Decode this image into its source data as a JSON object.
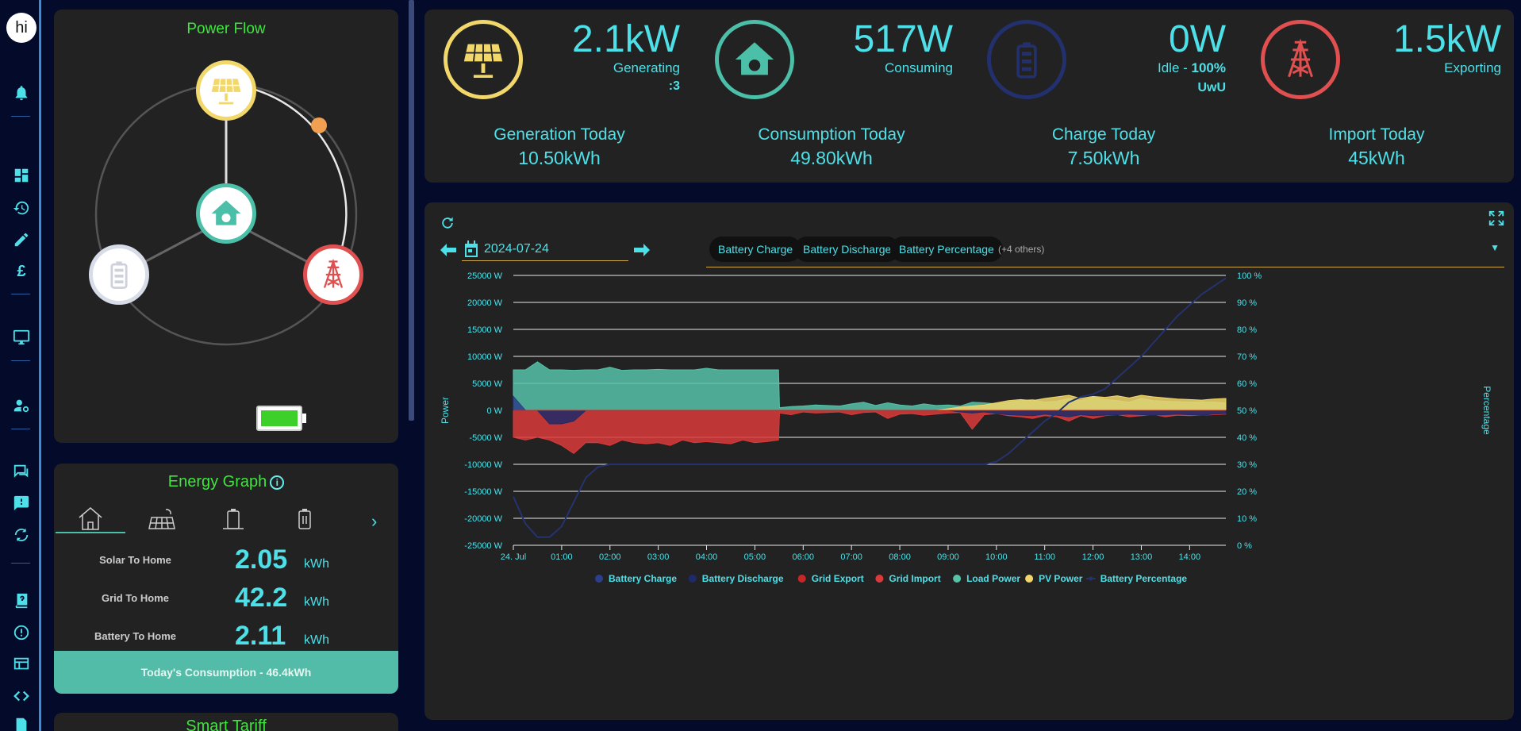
{
  "sidebar": {
    "avatar_text": "hi",
    "icons": [
      "bell-icon",
      "dashboard-icon",
      "history-icon",
      "edit-icon",
      "pound-icon",
      "monitor-icon",
      "user-settings-icon",
      "chat-icon",
      "feedback-icon",
      "sync-icon",
      "help-book-icon",
      "alert-icon",
      "table-edit-icon",
      "code-icon",
      "export-icon"
    ]
  },
  "power_flow": {
    "title": "Power Flow",
    "nodes": [
      "solar-panel-icon",
      "home-icon",
      "battery-icon",
      "grid-tower-icon"
    ],
    "colors": {
      "solar": "#f2d86a",
      "home": "#4bbfa8",
      "battery": "#d8dce8",
      "grid": "#e05050",
      "dot": "#f0a050"
    }
  },
  "energy_graph": {
    "title": "Energy Graph",
    "info_icon": "i",
    "tabs": [
      "home-icon",
      "solar-panels-icon",
      "battery-charge-icon",
      "battery-icon"
    ],
    "next_icon": "›",
    "rows": [
      {
        "label": "Solar To Home",
        "value": "2.05",
        "unit": "kWh"
      },
      {
        "label": "Grid To Home",
        "value": "42.2",
        "unit": "kWh"
      },
      {
        "label": "Battery To Home",
        "value": "2.11",
        "unit": "kWh"
      }
    ],
    "total": "Today's Consumption - 46.4kWh"
  },
  "smart_tariff": {
    "title": "Smart Tariff"
  },
  "stats": {
    "items": [
      {
        "value": "2.1kW",
        "label": "Generating",
        "sub": ":3",
        "icon": "solar-panel-icon",
        "color": "#f2d86a"
      },
      {
        "value": "517W",
        "label": "Consuming",
        "sub": "",
        "icon": "home-icon",
        "color": "#4bbfa8"
      },
      {
        "value": "0W",
        "label_prefix": "Idle - ",
        "label_bold": "100%",
        "sub": "UwU",
        "icon": "battery-icon",
        "color": "#22306e"
      },
      {
        "value": "1.5kW",
        "label": "Exporting",
        "sub": "",
        "icon": "grid-tower-icon",
        "color": "#e05050"
      }
    ],
    "today": [
      {
        "label": "Generation Today",
        "value": "10.50kWh"
      },
      {
        "label": "Consumption Today",
        "value": "49.80kWh"
      },
      {
        "label": "Charge Today",
        "value": "7.50kWh"
      },
      {
        "label": "Import Today",
        "value": "45kWh"
      }
    ]
  },
  "chart_controls": {
    "date": "2024-07-24",
    "chips": [
      "Battery Charge",
      "Battery Discharge",
      "Battery Percentage"
    ],
    "more": "(+4 others)",
    "dropdown": "▼"
  },
  "chart_data": {
    "type": "area",
    "ylabel_left": "Power",
    "ylabel_right": "Percentage",
    "ylim": [
      -25000,
      25000
    ],
    "y2lim": [
      0,
      100
    ],
    "yticks": [
      "25000 W",
      "20000 W",
      "15000 W",
      "10000 W",
      "5000 W",
      "0 W",
      "-5000 W",
      "-10000 W",
      "-15000 W",
      "-20000 W",
      "-25000 W"
    ],
    "y2ticks": [
      "100 %",
      "90 %",
      "80 %",
      "70 %",
      "60 %",
      "50 %",
      "40 %",
      "30 %",
      "20 %",
      "10 %",
      "0 %"
    ],
    "xticks": [
      "24. Jul",
      "01:00",
      "02:00",
      "03:00",
      "04:00",
      "05:00",
      "06:00",
      "07:00",
      "08:00",
      "09:00",
      "10:00",
      "11:00",
      "12:00",
      "13:00",
      "14:00"
    ],
    "xlim": [
      0,
      14.75
    ],
    "x": [
      0,
      0.25,
      0.5,
      0.75,
      1,
      1.25,
      1.5,
      1.75,
      2,
      2.25,
      2.5,
      2.75,
      3,
      3.25,
      3.5,
      3.75,
      4,
      4.25,
      4.5,
      4.75,
      5,
      5.25,
      5.49,
      5.51,
      5.75,
      6,
      6.25,
      6.5,
      6.75,
      7,
      7.25,
      7.5,
      7.75,
      8,
      8.25,
      8.5,
      8.75,
      9,
      9.25,
      9.5,
      9.75,
      10,
      10.25,
      10.5,
      10.75,
      11,
      11.25,
      11.5,
      11.75,
      12,
      12.25,
      12.5,
      12.75,
      13,
      13.25,
      13.5,
      13.75,
      14,
      14.25,
      14.5,
      14.75
    ],
    "series": [
      {
        "name": "Battery Charge",
        "color": "#2c3f8c",
        "values": [
          2600,
          0,
          0,
          0,
          0,
          0,
          0,
          0,
          0,
          0,
          0,
          0,
          0,
          0,
          0,
          0,
          0,
          0,
          0,
          0,
          0,
          0,
          0,
          0,
          0,
          0,
          0,
          0,
          0,
          0,
          0,
          0,
          0,
          0,
          0,
          0,
          0,
          0,
          0,
          0,
          0,
          0,
          0,
          0,
          0,
          0,
          0,
          0,
          0,
          0,
          0,
          0,
          0,
          0,
          0,
          0,
          0,
          0,
          0,
          0,
          0
        ]
      },
      {
        "name": "Battery Discharge",
        "color": "#1f2a6a",
        "values": [
          0,
          0,
          0,
          -2500,
          -2500,
          -2000,
          0,
          0,
          0,
          0,
          0,
          0,
          0,
          0,
          0,
          0,
          0,
          0,
          0,
          0,
          0,
          0,
          0,
          0,
          0,
          0,
          0,
          0,
          0,
          0,
          0,
          0,
          0,
          0,
          0,
          0,
          0,
          0,
          -300,
          -500,
          -300,
          -600,
          -800,
          -900,
          -1000,
          -700,
          -900,
          -1200,
          -800,
          -1000,
          -900,
          -800,
          -700,
          -800,
          -900,
          -800,
          -700,
          -800,
          -900,
          -700,
          -600
        ]
      },
      {
        "name": "Grid Export",
        "color": "#c62828",
        "values": [
          0,
          0,
          0,
          0,
          0,
          0,
          0,
          0,
          0,
          0,
          0,
          0,
          0,
          0,
          0,
          0,
          0,
          0,
          0,
          0,
          0,
          0,
          0,
          0,
          0,
          0,
          0,
          0,
          0,
          0,
          0,
          0,
          0,
          0,
          0,
          0,
          0,
          0,
          0,
          0,
          0,
          0,
          0,
          0,
          0,
          0,
          0,
          0,
          0,
          0,
          0,
          0,
          0,
          0,
          0,
          0,
          0,
          0,
          0,
          0,
          0
        ]
      },
      {
        "name": "Grid Import",
        "color": "#d93a3a",
        "values": [
          -5000,
          -5500,
          -5000,
          -5500,
          -6500,
          -8000,
          -6000,
          -6000,
          -6500,
          -5500,
          -6000,
          -6200,
          -6000,
          -6500,
          -5500,
          -6000,
          -5800,
          -6000,
          -6200,
          -5500,
          -6000,
          -5800,
          -5500,
          -500,
          -800,
          -300,
          -500,
          -400,
          -300,
          -800,
          -400,
          -300,
          -1500,
          -700,
          -600,
          -900,
          -700,
          -500,
          -400,
          -3500,
          -800,
          -600,
          -1000,
          -1200,
          -1500,
          -1000,
          -1200,
          -2000,
          -1000,
          -1500,
          -1000,
          -800,
          -1200,
          -1000,
          -800,
          -1200,
          -900,
          -1000,
          -900,
          -800,
          -700
        ]
      },
      {
        "name": "Load Power",
        "color": "#56c2a8",
        "values": [
          7500,
          7500,
          9000,
          7500,
          7500,
          7400,
          7500,
          7500,
          8000,
          7400,
          7500,
          7500,
          7600,
          7500,
          7500,
          7500,
          7800,
          7500,
          7500,
          7500,
          7500,
          7500,
          7500,
          500,
          700,
          800,
          1000,
          900,
          800,
          1200,
          1500,
          900,
          1400,
          1000,
          800,
          1200,
          900,
          1000,
          800,
          1500,
          1400,
          1200,
          1500,
          1800,
          2000,
          1500,
          1700,
          2200,
          1800,
          2500,
          2000,
          1800,
          1500,
          2200,
          1800,
          1700,
          1600,
          1500,
          1600,
          1500,
          1400
        ]
      },
      {
        "name": "PV Power",
        "color": "#f2d66b",
        "values": [
          0,
          0,
          0,
          0,
          0,
          0,
          0,
          0,
          0,
          0,
          0,
          0,
          0,
          0,
          0,
          0,
          0,
          0,
          0,
          0,
          0,
          0,
          0,
          0,
          0,
          0,
          0,
          0,
          0,
          0,
          0,
          0,
          0,
          0,
          0,
          0,
          0,
          300,
          600,
          800,
          1000,
          1400,
          1800,
          2000,
          1800,
          2200,
          2500,
          2800,
          2200,
          2600,
          2400,
          2700,
          2300,
          2800,
          2500,
          2300,
          2100,
          2000,
          1900,
          2100,
          2200
        ]
      },
      {
        "name": "Battery Percentage",
        "color": "#24336f",
        "axis": "percent",
        "values": [
          18,
          8,
          3,
          3,
          7,
          16,
          25,
          29,
          30,
          30,
          30,
          30,
          30,
          30,
          30,
          30,
          30,
          30,
          30,
          30,
          30,
          30,
          30,
          30,
          30,
          30,
          30,
          30,
          30,
          30,
          30,
          30,
          30,
          30,
          30,
          30,
          30,
          30,
          30,
          30,
          30,
          31,
          34,
          38,
          42,
          46,
          49,
          53,
          55,
          56,
          58,
          62,
          66,
          70,
          75,
          80,
          85,
          89,
          93,
          96,
          99
        ]
      }
    ]
  }
}
